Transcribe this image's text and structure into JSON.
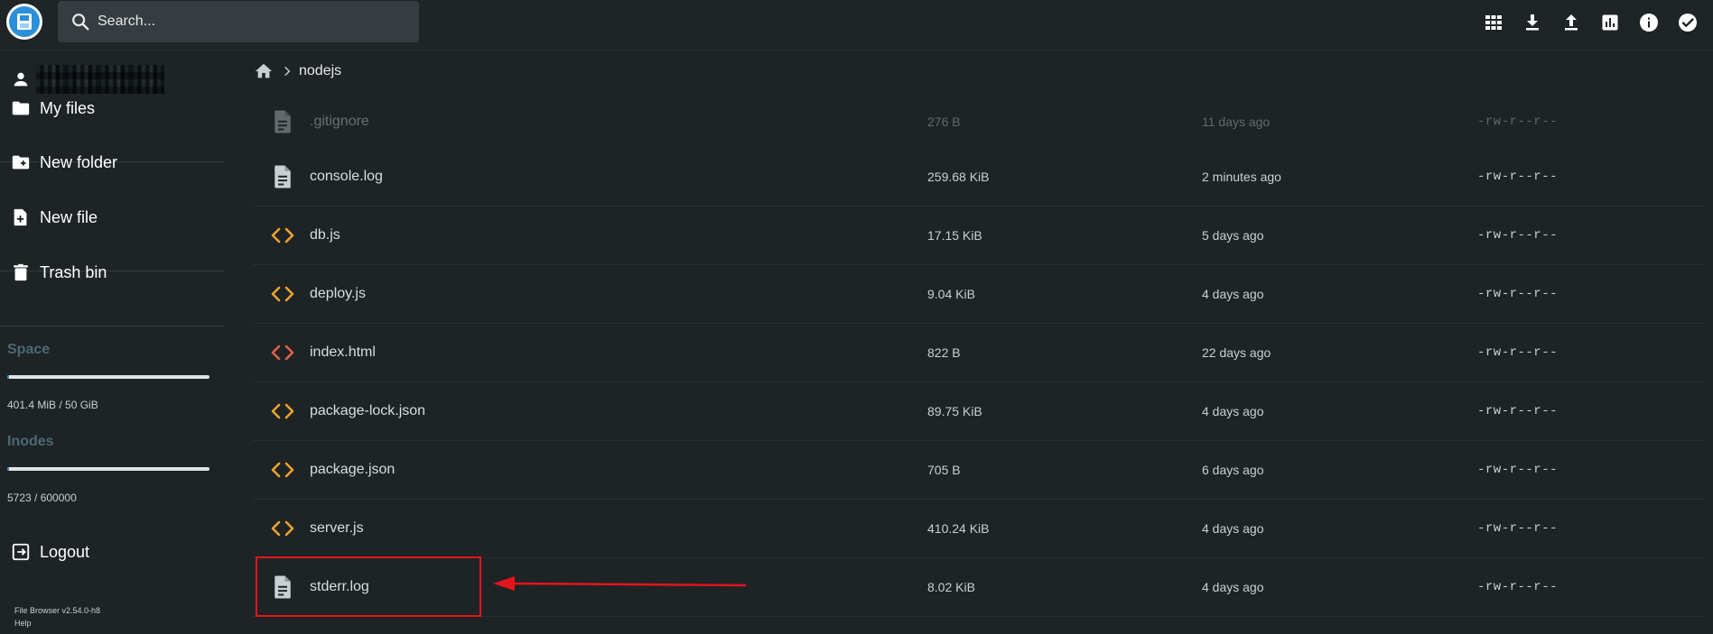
{
  "header": {
    "search_placeholder": "Search...",
    "actions": [
      {
        "name": "grid-view-icon"
      },
      {
        "name": "download-icon"
      },
      {
        "name": "upload-icon"
      },
      {
        "name": "chart-icon"
      },
      {
        "name": "info-icon"
      },
      {
        "name": "check-circle-icon"
      }
    ]
  },
  "sidebar": {
    "nav": {
      "my_files": "My files",
      "new_folder": "New folder",
      "new_file": "New file",
      "trash_bin": "Trash bin",
      "logout": "Logout"
    },
    "space": {
      "title": "Space",
      "value": "401.4 MiB / 50 GiB",
      "fraction": 0.008
    },
    "inodes": {
      "title": "Inodes",
      "value": "5723 / 600000",
      "fraction": 0.0095
    },
    "version": "File Browser v2.54.0-h8",
    "help": "Help"
  },
  "breadcrumb": {
    "folder": "nodejs"
  },
  "files": [
    {
      "name": ".gitignore",
      "size": "276 B",
      "modified": "11 days ago",
      "perms": "-rw-r--r--",
      "icon": "document-icon"
    },
    {
      "name": "console.log",
      "size": "259.68 KiB",
      "modified": "2 minutes ago",
      "perms": "-rw-r--r--",
      "icon": "document-icon"
    },
    {
      "name": "db.js",
      "size": "17.15 KiB",
      "modified": "5 days ago",
      "perms": "-rw-r--r--",
      "icon": "code-icon"
    },
    {
      "name": "deploy.js",
      "size": "9.04 KiB",
      "modified": "4 days ago",
      "perms": "-rw-r--r--",
      "icon": "code-icon"
    },
    {
      "name": "index.html",
      "size": "822 B",
      "modified": "22 days ago",
      "perms": "-rw-r--r--",
      "icon": "html-code-icon"
    },
    {
      "name": "package-lock.json",
      "size": "89.75 KiB",
      "modified": "4 days ago",
      "perms": "-rw-r--r--",
      "icon": "code-icon"
    },
    {
      "name": "package.json",
      "size": "705 B",
      "modified": "6 days ago",
      "perms": "-rw-r--r--",
      "icon": "code-icon"
    },
    {
      "name": "server.js",
      "size": "410.24 KiB",
      "modified": "4 days ago",
      "perms": "-rw-r--r--",
      "icon": "code-icon"
    },
    {
      "name": "stderr.log",
      "size": "8.02 KiB",
      "modified": "4 days ago",
      "perms": "-rw-r--r--",
      "icon": "document-icon"
    }
  ],
  "colors": {
    "accent": "#2b8fd9",
    "code_icon": "#f0a030",
    "html_icon": "#e0604a",
    "annotation": "#e4141b"
  }
}
